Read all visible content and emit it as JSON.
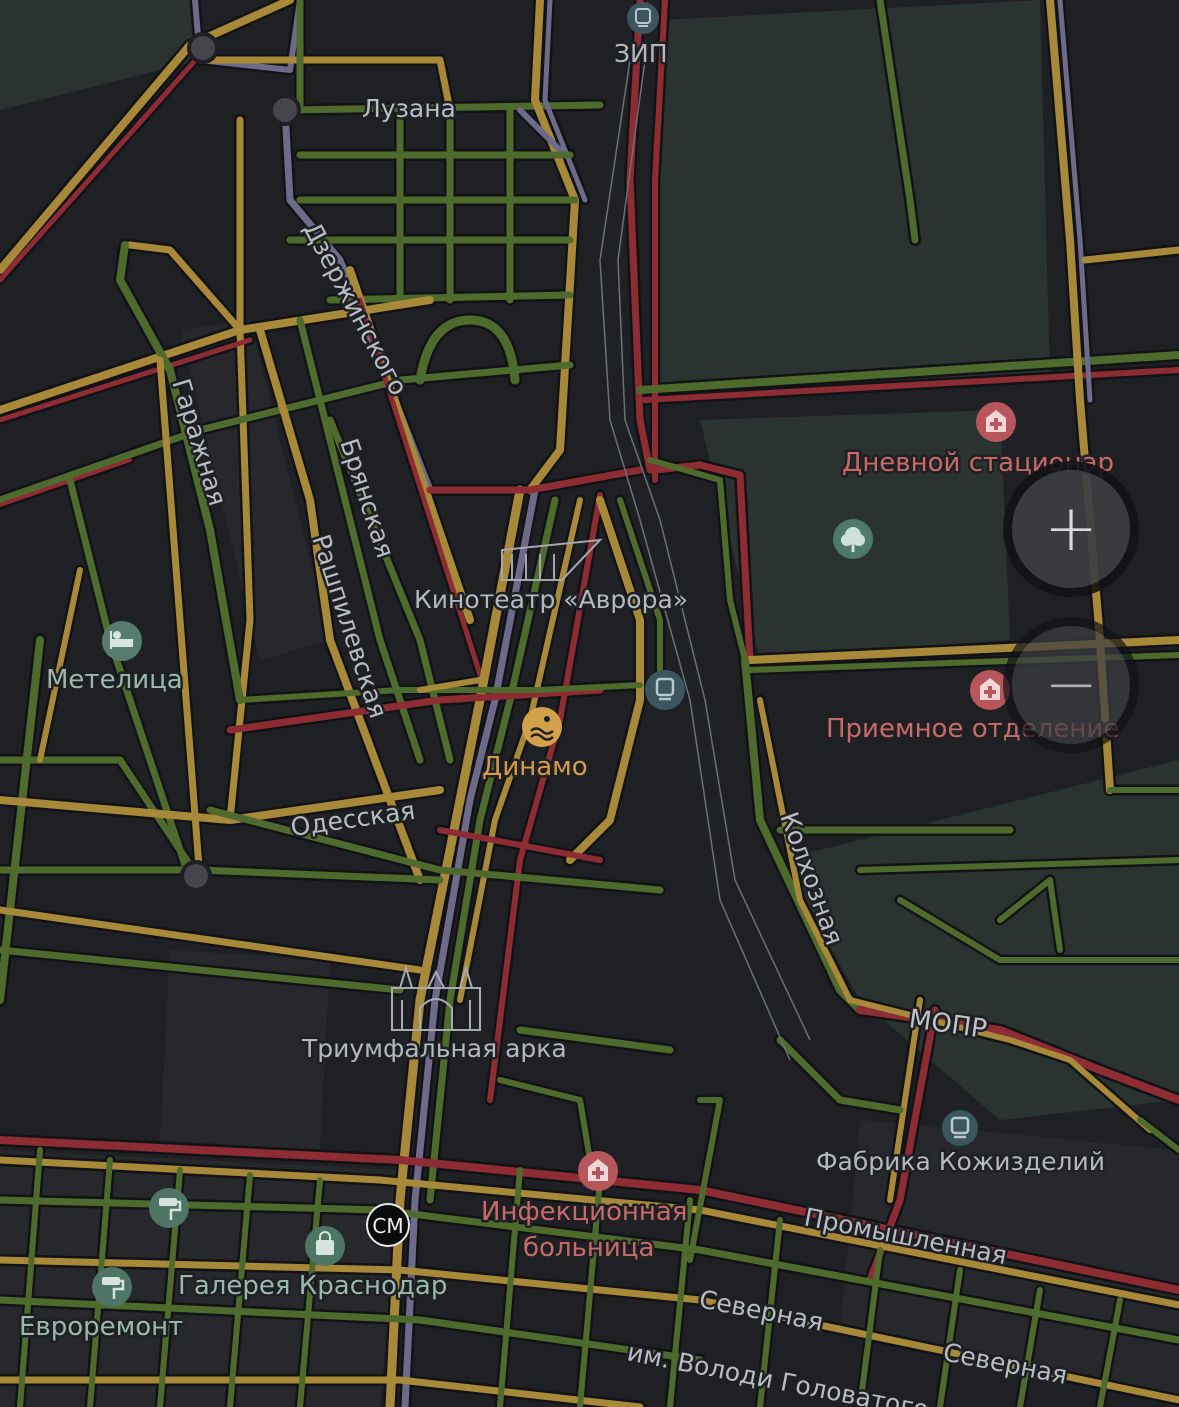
{
  "map": {
    "colors": {
      "background": "#1e2024",
      "park": "#2b3330",
      "block": "#26282c",
      "road_green": "#4f6a2d",
      "road_yellow": "#a8893a",
      "road_red": "#8e2c34",
      "road_lilac": "#6e6a8a"
    },
    "streets": {
      "luzana": "Лузана",
      "dzerzhinskogo": "Дзержинского",
      "garazhnaya": "Гаражная",
      "bryanskaya": "Брянская",
      "rashpilevskaya": "Рашпилевская",
      "odesskaya": "Одесская",
      "kolkhoznaya": "Колхозная",
      "promyshlennaya": "Промышленная",
      "severnaya_1": "Северная",
      "severnaya_2": "Северная",
      "volodi_golovatogo": "им. Володи Головатого"
    },
    "places": {
      "zip": {
        "label": "ЗИП",
        "icon": "tram-icon"
      },
      "kinoteatr": {
        "label": "Кинотеатр «Аврора»",
        "icon": "cinema-landmark-icon"
      },
      "dynamo": {
        "label": "Динамо",
        "icon": "swimming-icon"
      },
      "metelitsa": {
        "label": "Метелица",
        "icon": "hotel-icon"
      },
      "dnevnoy": {
        "label": "Дневной стационар",
        "icon": "hospital-icon"
      },
      "park": {
        "icon": "park-icon"
      },
      "priemnoe": {
        "label": "Приемное отделение",
        "icon": "hospital-icon"
      },
      "tram_stop": {
        "icon": "tram-icon"
      },
      "triumfalnaya": {
        "label": "Триумфальная арка",
        "icon": "arch-landmark-icon"
      },
      "mopr": {
        "label": "МОПР"
      },
      "fabrika": {
        "label": "Фабрика Кожизделий",
        "icon": "tram-icon"
      },
      "infektsionnaya_1": {
        "label": "Инфекционная",
        "icon": "hospital-icon"
      },
      "infektsionnaya_2": {
        "label": "больница"
      },
      "galereya": {
        "label": "Галерея Краснодар",
        "icon": "shopping-bag-icon"
      },
      "sm": {
        "label": "СМ"
      },
      "evroremont": {
        "label": "Евроремонт",
        "icon": "paint-roller-icon"
      },
      "paint_shop": {
        "icon": "paint-roller-icon"
      }
    }
  },
  "controls": {
    "zoom_in": "+",
    "zoom_out": "−"
  }
}
